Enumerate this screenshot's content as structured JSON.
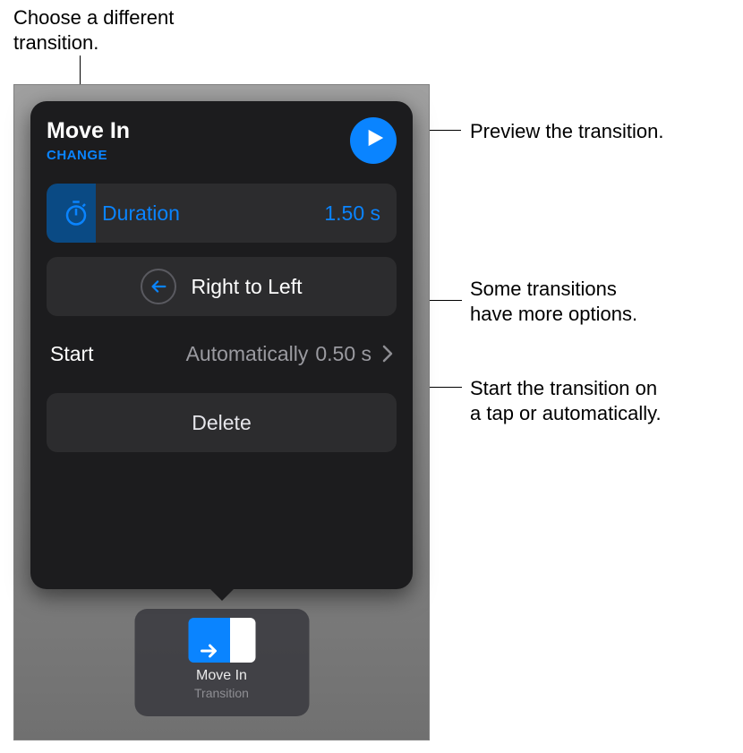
{
  "callouts": {
    "change": "Choose a different\ntransition.",
    "preview": "Preview the transition.",
    "options": "Some transitions\nhave more options.",
    "start": "Start the transition on\na tap or automatically."
  },
  "popover": {
    "title": "Move In",
    "change_label": "CHANGE",
    "duration": {
      "label": "Duration",
      "value": "1.50 s"
    },
    "direction": {
      "label": "Right to Left"
    },
    "start": {
      "label": "Start",
      "mode": "Automatically",
      "delay": "0.50 s"
    },
    "delete_label": "Delete"
  },
  "chip": {
    "title": "Move In",
    "subtitle": "Transition"
  }
}
